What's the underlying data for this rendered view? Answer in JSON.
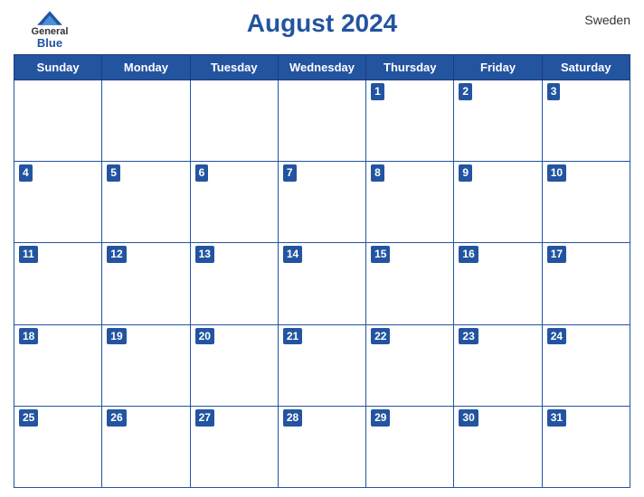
{
  "header": {
    "logo": {
      "general": "General",
      "blue": "Blue",
      "icon_label": "general-blue-logo"
    },
    "title": "August 2024",
    "country": "Sweden"
  },
  "calendar": {
    "days_of_week": [
      "Sunday",
      "Monday",
      "Tuesday",
      "Wednesday",
      "Thursday",
      "Friday",
      "Saturday"
    ],
    "weeks": [
      [
        null,
        null,
        null,
        null,
        1,
        2,
        3
      ],
      [
        4,
        5,
        6,
        7,
        8,
        9,
        10
      ],
      [
        11,
        12,
        13,
        14,
        15,
        16,
        17
      ],
      [
        18,
        19,
        20,
        21,
        22,
        23,
        24
      ],
      [
        25,
        26,
        27,
        28,
        29,
        30,
        31
      ]
    ]
  }
}
